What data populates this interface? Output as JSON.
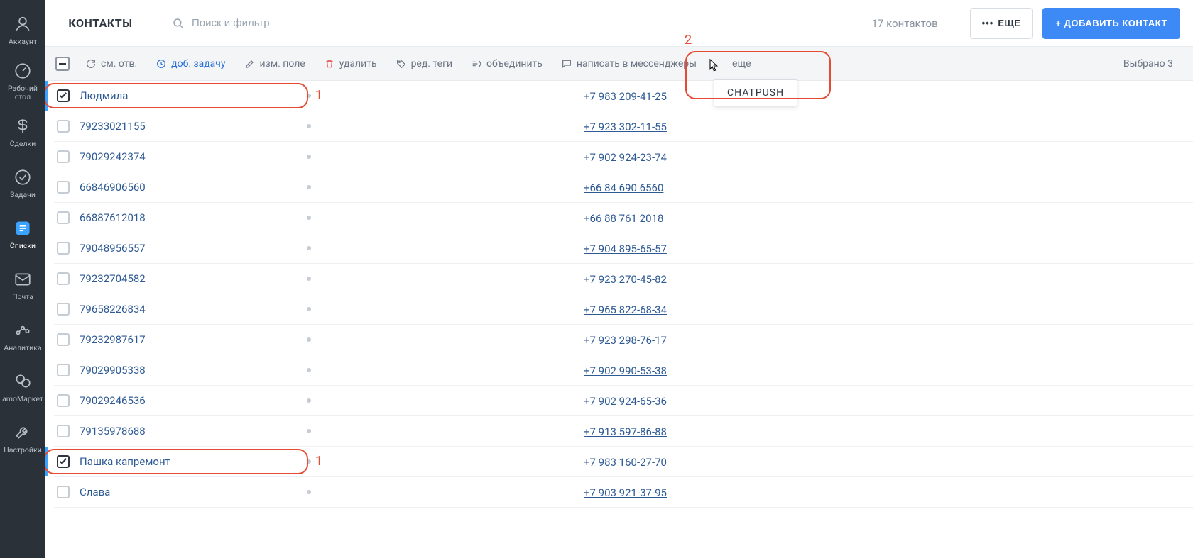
{
  "sidebar": [
    {
      "key": "account",
      "label": "Аккаунт"
    },
    {
      "key": "desktop",
      "label": "Рабочий\nстол"
    },
    {
      "key": "deals",
      "label": "Сделки"
    },
    {
      "key": "tasks",
      "label": "Задачи"
    },
    {
      "key": "lists",
      "label": "Списки",
      "active": true
    },
    {
      "key": "mail",
      "label": "Почта"
    },
    {
      "key": "analytics",
      "label": "Аналитика"
    },
    {
      "key": "market",
      "label": "amoМаркет"
    },
    {
      "key": "settings",
      "label": "Настройки"
    }
  ],
  "header": {
    "title": "КОНТАКТЫ",
    "search_placeholder": "Поиск и фильтр",
    "count_text": "17 контактов",
    "more_label": "ЕЩЕ",
    "add_label": "+ ДОБАВИТЬ КОНТАКТ"
  },
  "toolbar": {
    "actions": {
      "change_resp": "см. отв.",
      "add_task": "доб. задачу",
      "edit_field": "изм. поле",
      "delete": "удалить",
      "edit_tags": "ред. теги",
      "merge": "объединить",
      "write_msg": "написать в мессенджеры",
      "more": "еще"
    },
    "selected_text": "Выбрано 3",
    "dropdown_item": "CHATPUSH"
  },
  "annotations": {
    "n1": "1",
    "n2": "2"
  },
  "contacts": [
    {
      "selected": true,
      "name": "Людмила",
      "phone": "+7 983 209-41-25"
    },
    {
      "selected": false,
      "name": "79233021155",
      "phone": "+7 923 302-11-55"
    },
    {
      "selected": false,
      "name": "79029242374",
      "phone": "+7 902 924-23-74"
    },
    {
      "selected": false,
      "name": "66846906560",
      "phone": "+66 84 690 6560"
    },
    {
      "selected": false,
      "name": "66887612018",
      "phone": "+66 88 761 2018"
    },
    {
      "selected": false,
      "name": "79048956557",
      "phone": "+7 904 895-65-57"
    },
    {
      "selected": false,
      "name": "79232704582",
      "phone": "+7 923 270-45-82"
    },
    {
      "selected": false,
      "name": "79658226834",
      "phone": "+7 965 822-68-34"
    },
    {
      "selected": false,
      "name": "79232987617",
      "phone": "+7 923 298-76-17"
    },
    {
      "selected": false,
      "name": "79029905338",
      "phone": "+7 902 990-53-38"
    },
    {
      "selected": false,
      "name": "79029246536",
      "phone": "+7 902 924-65-36"
    },
    {
      "selected": false,
      "name": "79135978688",
      "phone": "+7 913 597-86-88"
    },
    {
      "selected": true,
      "name": "Пашка капремонт",
      "phone": "+7 983 160-27-70"
    },
    {
      "selected": false,
      "name": "Слава",
      "phone": "+7 903 921-37-95"
    }
  ]
}
